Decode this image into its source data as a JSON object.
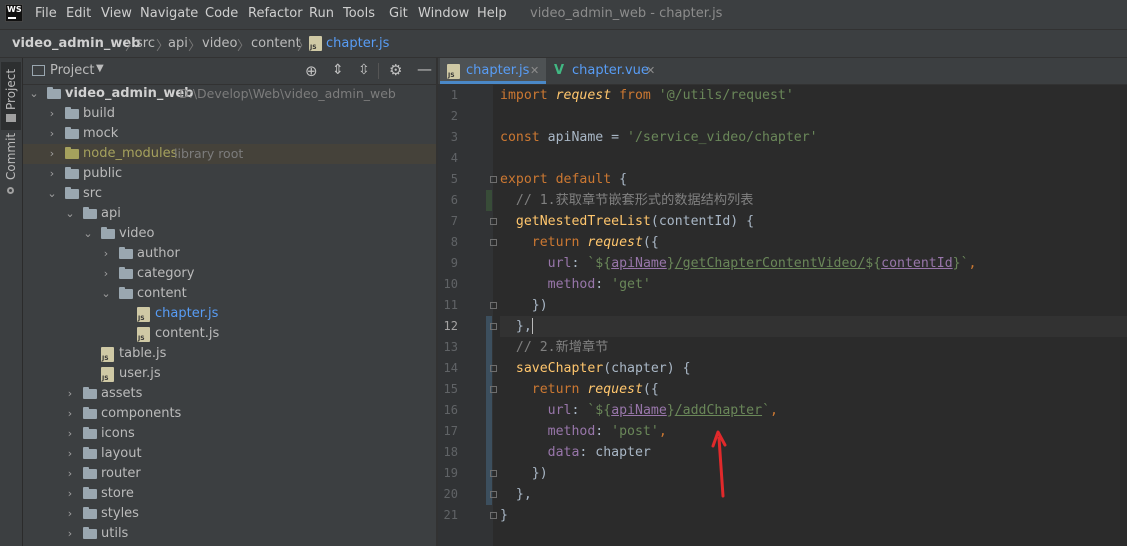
{
  "menubar": {
    "logo": "WS",
    "items": [
      "File",
      "Edit",
      "View",
      "Navigate",
      "Code",
      "Refactor",
      "Run",
      "Tools",
      "Git",
      "Window",
      "Help"
    ],
    "title": "video_admin_web - chapter.js"
  },
  "breadcrumbs": [
    "video_admin_web",
    "src",
    "api",
    "video",
    "content",
    "chapter.js"
  ],
  "sidestrip": {
    "project_tab": "Project",
    "commit_tab": "Commit"
  },
  "project_panel": {
    "title": "Project",
    "tree": [
      {
        "name": "video_admin_web",
        "path": "D:\\Develop\\Web\\video_admin_web"
      },
      {
        "name": "build"
      },
      {
        "name": "mock"
      },
      {
        "name": "node_modules",
        "note": "library root"
      },
      {
        "name": "public"
      },
      {
        "name": "src"
      },
      {
        "name": "api"
      },
      {
        "name": "video"
      },
      {
        "name": "author"
      },
      {
        "name": "category"
      },
      {
        "name": "content"
      },
      {
        "name": "chapter.js"
      },
      {
        "name": "content.js"
      },
      {
        "name": "table.js"
      },
      {
        "name": "user.js"
      },
      {
        "name": "assets"
      },
      {
        "name": "components"
      },
      {
        "name": "icons"
      },
      {
        "name": "layout"
      },
      {
        "name": "router"
      },
      {
        "name": "store"
      },
      {
        "name": "styles"
      },
      {
        "name": "utils"
      }
    ]
  },
  "editor": {
    "tabs": [
      {
        "label": "chapter.js",
        "active": true
      },
      {
        "label": "chapter.vue",
        "active": false
      }
    ],
    "current_line": 12,
    "lines": [
      "1",
      "2",
      "3",
      "4",
      "5",
      "6",
      "7",
      "8",
      "9",
      "10",
      "11",
      "12",
      "13",
      "14",
      "15",
      "16",
      "17",
      "18",
      "19",
      "20",
      "21"
    ],
    "code": {
      "l1": [
        "import ",
        "request",
        " from ",
        "'@/utils/request'"
      ],
      "l3": [
        "const ",
        "apiName = ",
        "'/service_video/chapter'"
      ],
      "l5": [
        "export default ",
        "{"
      ],
      "l6": "  // 1.获取章节嵌套形式的数据结构列表",
      "l7": [
        "  ",
        "getNestedTreeList",
        "(contentId) {"
      ],
      "l8": [
        "    ",
        "return ",
        "request",
        "({"
      ],
      "l9": [
        "      ",
        "url",
        ": ",
        "`${",
        "apiName",
        "}",
        "/getChapterContentVideo/",
        "${",
        "contentId",
        "}",
        "`",
        ","
      ],
      "l10": [
        "      ",
        "method",
        ": ",
        "'get'"
      ],
      "l11": "    })",
      "l12": "  },",
      "l13": "  // 2.新增章节",
      "l14": [
        "  ",
        "saveChapter",
        "(chapter) {"
      ],
      "l15": [
        "    ",
        "return ",
        "request",
        "({"
      ],
      "l16": [
        "      ",
        "url",
        ": ",
        "`${",
        "apiName",
        "}",
        "/addChapter",
        "`",
        ","
      ],
      "l17": [
        "      ",
        "method",
        ": ",
        "'post'",
        ","
      ],
      "l18": [
        "      ",
        "data",
        ": chapter"
      ],
      "l19": "    })",
      "l20": "  },",
      "l21": "}"
    }
  },
  "colors": {
    "annotation_arrow": "#e0292b",
    "accent": "#4a88c7"
  }
}
